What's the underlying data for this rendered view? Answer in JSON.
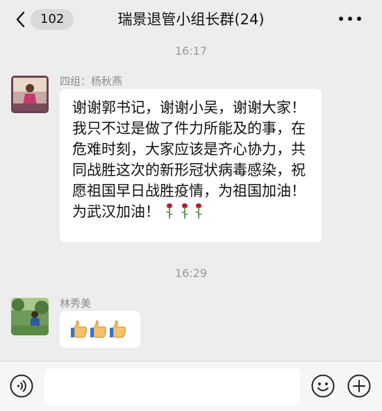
{
  "header": {
    "back_count": "102",
    "title": "瑞景退管小组长群(24)"
  },
  "messages": [
    {
      "time": "16:17",
      "sender": "四组：杨秋燕",
      "text": "谢谢郭书记，谢谢小吴，谢谢大家！我只不过是做了件力所能及的事，在危难时刻，大家应该是齐心协力，共同战胜这次的新形冠状病毒感染，祝愿祖国早日战胜疫情，为祖国加油！为武汉加油！",
      "emoji": [
        "rose",
        "rose",
        "rose"
      ]
    },
    {
      "time": "16:29",
      "sender": "林秀美",
      "emoji": [
        "thumbs-up",
        "thumbs-up",
        "thumbs-up"
      ]
    }
  ],
  "input": {
    "placeholder": ""
  },
  "colors": {
    "background": "#ededed",
    "bubble": "#ffffff",
    "meta_text": "#8c8c8c"
  },
  "icons": {
    "back": "chevron-left-icon",
    "more": "more-dots-icon",
    "voice": "voice-icon",
    "emoji": "emoji-icon",
    "plus": "plus-icon"
  }
}
